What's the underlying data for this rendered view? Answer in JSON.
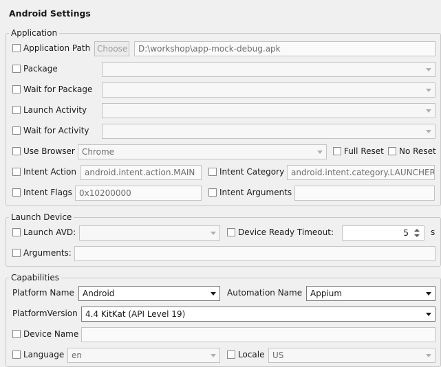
{
  "title": "Android Settings",
  "application": {
    "legend": "Application",
    "app_path_label": "Application Path",
    "choose_label": "Choose",
    "app_path_value": "D:\\workshop\\app-mock-debug.apk",
    "package_label": "Package",
    "package_value": "",
    "wait_package_label": "Wait for Package",
    "wait_package_value": "",
    "launch_activity_label": "Launch Activity",
    "launch_activity_value": "",
    "wait_activity_label": "Wait for Activity",
    "wait_activity_value": "",
    "use_browser_label": "Use Browser",
    "browser_value": "Chrome",
    "full_reset_label": "Full Reset",
    "no_reset_label": "No Reset",
    "intent_action_label": "Intent Action",
    "intent_action_value": "android.intent.action.MAIN",
    "intent_category_label": "Intent Category",
    "intent_category_value": "android.intent.category.LAUNCHER",
    "intent_flags_label": "Intent Flags",
    "intent_flags_value": "0x10200000",
    "intent_args_label": "Intent Arguments",
    "intent_args_value": ""
  },
  "launch_device": {
    "legend": "Launch Device",
    "launch_avd_label": "Launch AVD:",
    "launch_avd_value": "",
    "device_ready_label": "Device Ready Timeout:",
    "device_ready_value": "5",
    "device_ready_unit": "s",
    "arguments_label": "Arguments:",
    "arguments_value": ""
  },
  "capabilities": {
    "legend": "Capabilities",
    "platform_name_label": "Platform Name",
    "platform_name_value": "Android",
    "automation_name_label": "Automation Name",
    "automation_name_value": "Appium",
    "platform_version_label": "PlatformVersion",
    "platform_version_value": "4.4 KitKat (API Level 19)",
    "device_name_label": "Device Name",
    "device_name_value": "",
    "language_label": "Language",
    "language_value": "en",
    "locale_label": "Locale",
    "locale_value": "US"
  }
}
